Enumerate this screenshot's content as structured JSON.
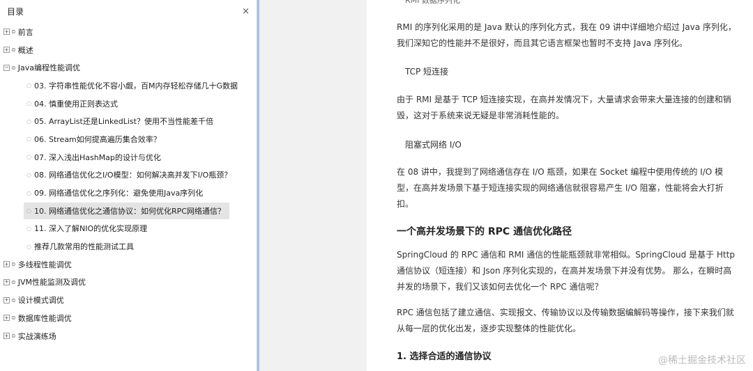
{
  "sidebar": {
    "title": "目录",
    "close_icon": "×",
    "items": [
      {
        "label": "前言",
        "level": 0,
        "expander": "+"
      },
      {
        "label": "概述",
        "level": 0,
        "expander": "+"
      },
      {
        "label": "Java编程性能调优",
        "level": 0,
        "expander": "−"
      },
      {
        "label": "03. 字符串性能优化不容小觑，百M内存轻松存储几十G数据",
        "level": 1
      },
      {
        "label": "04. 慎重使用正则表达式",
        "level": 1
      },
      {
        "label": "05. ArrayList还是LinkedList？使用不当性能差千倍",
        "level": 1
      },
      {
        "label": "06. Stream如何提高遍历集合效率？",
        "level": 1
      },
      {
        "label": "07. 深入浅出HashMap的设计与优化",
        "level": 1
      },
      {
        "label": "08. 网络通信优化之I/O模型：如何解决高并发下I/O瓶颈？",
        "level": 1
      },
      {
        "label": "09. 网络通信优化之序列化：避免使用Java序列化",
        "level": 1
      },
      {
        "label": "10. 网络通信优化之通信协议：如何优化RPC网络通信？",
        "level": 1,
        "selected": true
      },
      {
        "label": "11. 深入了解NIO的优化实现原理",
        "level": 1
      },
      {
        "label": "推荐几款常用的性能测试工具",
        "level": 1
      },
      {
        "label": "多线程性能调优",
        "level": 0,
        "expander": "+"
      },
      {
        "label": "JVM性能监测及调优",
        "level": 0,
        "expander": "+"
      },
      {
        "label": "设计模式调优",
        "level": 0,
        "expander": "+"
      },
      {
        "label": "数据库性能调优",
        "level": 0,
        "expander": "+"
      },
      {
        "label": "实战演练场",
        "level": 0,
        "expander": "+"
      }
    ]
  },
  "content": {
    "cut_heading": "RMI 数据序列化",
    "p1": "RMI 的序列化采用的是 Java 默认的序列化方式，我在 09 讲中详细地介绍过 Java 序列化，我们深知它的性能并不是很好，而且其它语言框架也暂时不支持 Java 序列化。",
    "sub1": "TCP 短连接",
    "p2": "由于 RMI 是基于 TCP 短连接实现，在高并发情况下，大量请求会带来大量连接的创建和销毁，这对于系统来说无疑是非常消耗性能的。",
    "sub2": "阻塞式网络 I/O",
    "p3": "在 08 讲中，我提到了网络通信存在 I/O 瓶颈，如果在 Socket 编程中使用传统的 I/O 模型，在高并发场景下基于短连接实现的网络通信就很容易产生 I/O 阻塞，性能将会大打折扣。",
    "h_section": "一个高并发场景下的 RPC 通信优化路径",
    "p4": "SpringCloud 的 RPC 通信和 RMI 通信的性能瓶颈就非常相似。SpringCloud 是基于 Http 通信协议（短连接）和 Json 序列化实现的，在高并发场景下并没有优势。 那么，在瞬时高并发的场景下，我们又该如何去优化一个 RPC 通信呢？",
    "p5": "RPC 通信包括了建立通信、实现报文、传输协议以及传输数据编解码等操作，接下来我们就从每一层的优化出发，逐步实现整体的性能优化。",
    "h_sub": "1. 选择合适的通信协议"
  },
  "watermark": "@稀土掘金技术社区"
}
